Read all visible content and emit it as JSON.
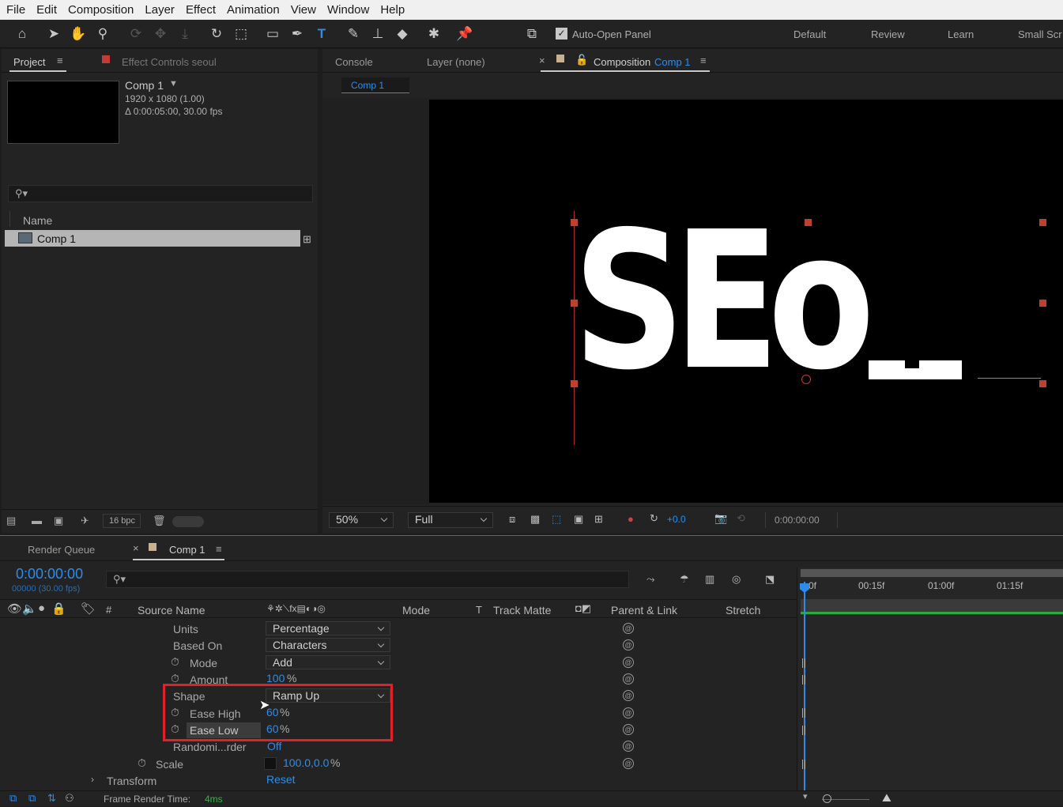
{
  "menu": [
    "File",
    "Edit",
    "Composition",
    "Layer",
    "Effect",
    "Animation",
    "View",
    "Window",
    "Help"
  ],
  "toolbar": {
    "auto_open": "Auto-Open Panel",
    "workspaces": [
      "Default",
      "Review",
      "Learn",
      "Small Scr"
    ]
  },
  "project": {
    "tab": "Project",
    "effect_controls": "Effect Controls seoul",
    "comp_name": "Comp 1",
    "comp_res": "1920 x 1080 (1.00)",
    "comp_dur": "Δ 0:00:05:00, 30.00 fps",
    "search_placeholder": "",
    "col_name": "Name",
    "item": "Comp 1",
    "bpc": "16 bpc"
  },
  "viewer": {
    "tabs": [
      "Console",
      "Layer (none)"
    ],
    "comp_tab_label": "Composition",
    "comp_tab_name": "Comp 1",
    "breadcrumb": "Comp 1",
    "text": "SEo",
    "zoom": "50%",
    "quality": "Full",
    "exposure": "+0.0",
    "timecode": "0:00:00:00"
  },
  "timeline": {
    "tabs": [
      "Render Queue",
      "Comp 1"
    ],
    "timecode": "0:00:00:00",
    "frame_info": "00000 (30.00 fps)",
    "headers": {
      "num": "#",
      "source": "Source Name",
      "mode": "Mode",
      "t": "T",
      "track": "Track Matte",
      "parent": "Parent & Link",
      "stretch": "Stretch"
    },
    "ruler": [
      "0f",
      "00:15f",
      "01:00f",
      "01:15f"
    ],
    "rows": [
      {
        "label": "Units",
        "value": "Percentage"
      },
      {
        "label": "Based On",
        "value": "Characters"
      },
      {
        "label": "Mode",
        "value": "Add"
      },
      {
        "label": "Amount",
        "value": "100",
        "unit": "%"
      },
      {
        "label": "Shape",
        "value": "Ramp Up"
      },
      {
        "label": "Ease High",
        "value": "60",
        "unit": "%"
      },
      {
        "label": "Ease Low",
        "value": "60",
        "unit": "%"
      },
      {
        "label": "Randomi...rder",
        "value": "Off"
      },
      {
        "label": "Scale",
        "value": "100.0,0.0",
        "unit": "%"
      },
      {
        "label": "Transform",
        "value": "Reset"
      }
    ],
    "render_time_label": "Frame Render Time:",
    "render_time": "4ms"
  },
  "colors": {
    "accent": "#2d8ceb",
    "highlight_box": "#e0202a",
    "handle": "#c04030"
  }
}
